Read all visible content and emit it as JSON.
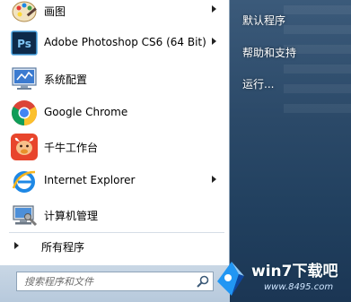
{
  "start_menu": {
    "programs": [
      {
        "label": "画图",
        "icon": "paint-icon",
        "has_submenu": true
      },
      {
        "label": "Adobe Photoshop CS6 (64 Bit)",
        "icon": "photoshop-icon",
        "has_submenu": true
      },
      {
        "label": "系统配置",
        "icon": "system-config-icon",
        "has_submenu": false
      },
      {
        "label": "Google Chrome",
        "icon": "chrome-icon",
        "has_submenu": false
      },
      {
        "label": "千牛工作台",
        "icon": "qianniu-icon",
        "has_submenu": false
      },
      {
        "label": "Internet Explorer",
        "icon": "ie-icon",
        "has_submenu": true
      },
      {
        "label": "计算机管理",
        "icon": "computer-management-icon",
        "has_submenu": false
      }
    ],
    "all_programs_label": "所有程序",
    "search": {
      "placeholder": "搜索程序和文件",
      "value": ""
    },
    "right_items": [
      {
        "label": "默认程序"
      },
      {
        "label": "帮助和支持"
      },
      {
        "label": "运行..."
      }
    ]
  },
  "watermark": {
    "text": "win7下载吧",
    "url_text": "www.8495.com",
    "colors": {
      "logo_blue": "#1e9be8",
      "text": "#ffffff"
    }
  },
  "colors": {
    "left_pane_bg": "#ffffff",
    "right_pane_bg": "#2b4968",
    "search_area_bg": "#c1d1e2"
  }
}
